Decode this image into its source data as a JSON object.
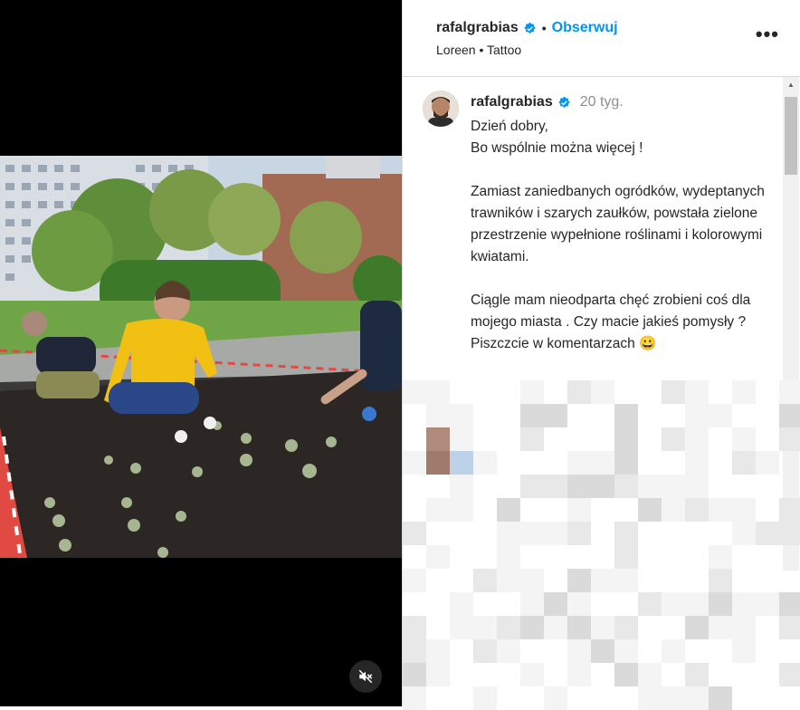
{
  "post": {
    "username": "rafalgrabias",
    "follow_label": "Obserwuj",
    "separator": "•",
    "location_text": "Loreen • Tattoo",
    "more_icon": "more-horizontal-icon",
    "comment_username": "rafalgrabias",
    "comment_time": "20 tyg.",
    "caption": "Dzień dobry,\nBo wspólnie można więcej !\n\nZamiast zaniedbanych ogródków, wydeptanych trawników i szarych zaułków, powstała zielone przestrzenie wypełnione roślinami i kolorowymi kwiatami.\n\nCiągle mam nieodparta chęć zrobieni coś dla mojego miasta . Czy macie jakieś pomysły ? Piszczcie w komentarzach 😀"
  },
  "media": {
    "mute_icon": "volume-off-icon"
  },
  "colors": {
    "follow": "#0095f6",
    "verified": "#0095f6",
    "text": "#262626",
    "muted": "#8e8e8e"
  }
}
